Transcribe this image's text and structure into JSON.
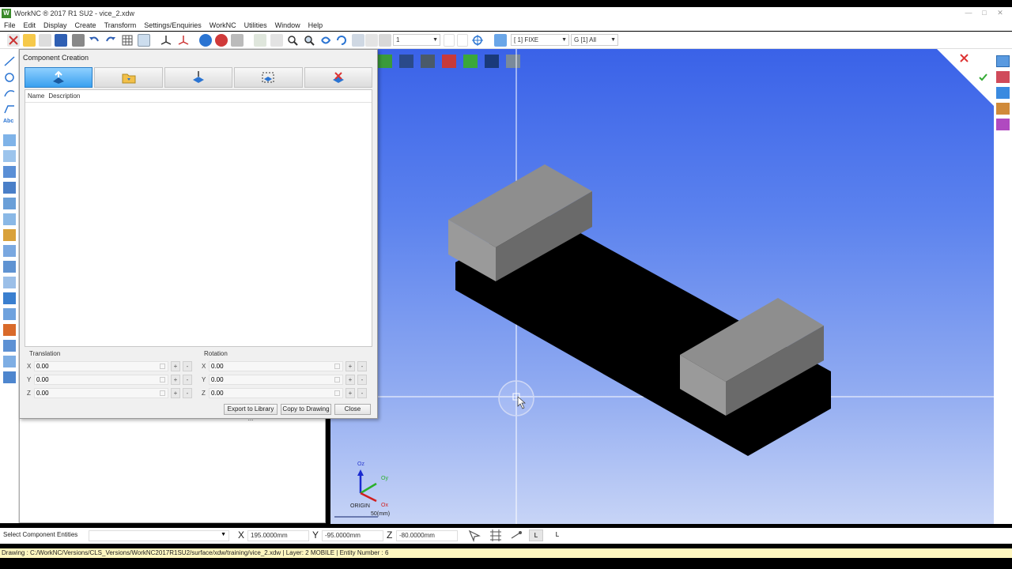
{
  "window": {
    "title": "WorkNC ® 2017 R1 SU2 - vice_2.xdw"
  },
  "menu": [
    "File",
    "Edit",
    "Display",
    "Create",
    "Transform",
    "Settings/Enquiries",
    "WorkNC",
    "Utilities",
    "Window",
    "Help"
  ],
  "toolbar": {
    "entity_field": "1",
    "layer_field": "[ 1] FIXE",
    "group_field": "G [1] All"
  },
  "dialog": {
    "title": "Component Creation",
    "list_columns": [
      "Name",
      "Description"
    ],
    "translation": {
      "label": "Translation",
      "x_label": "X",
      "y_label": "Y",
      "z_label": "Z",
      "x": "0.00",
      "y": "0.00",
      "z": "0.00"
    },
    "rotation": {
      "label": "Rotation",
      "x_label": "X",
      "y_label": "Y",
      "z_label": "Z",
      "x": "0.00",
      "y": "0.00",
      "z": "0.00"
    },
    "buttons": {
      "export": "Export to Library ...",
      "copy": "Copy to Drawing",
      "close": "Close"
    },
    "spin_plus": "+",
    "spin_minus": "-"
  },
  "viewport": {
    "axis": {
      "oz": "Oz",
      "oy": "Oy",
      "ox": "Ox",
      "origin": "ORIGIN",
      "scale": "50(mm)"
    }
  },
  "status": {
    "select_label": "Select Component Entities",
    "x_label": "X",
    "x_value": "195.0000mm",
    "y_label": "Y",
    "y_value": "-95.0000mm",
    "z_label": "Z",
    "z_value": "-80.0000mm",
    "l1": "L",
    "l2": "L"
  },
  "infobar": "Drawing : C:/WorkNC/Versions/CLS_Versions/WorkNC2017R1SU2/surface/xdw/training/vice_2.xdw | Layer: 2 MOBILE | Entity Number : 6",
  "colors": {
    "viewport_top": "#3a62e8",
    "viewport_bottom": "#c7d4f6",
    "active_tab": "#3aa0ef",
    "infobar": "#fff7bf"
  }
}
